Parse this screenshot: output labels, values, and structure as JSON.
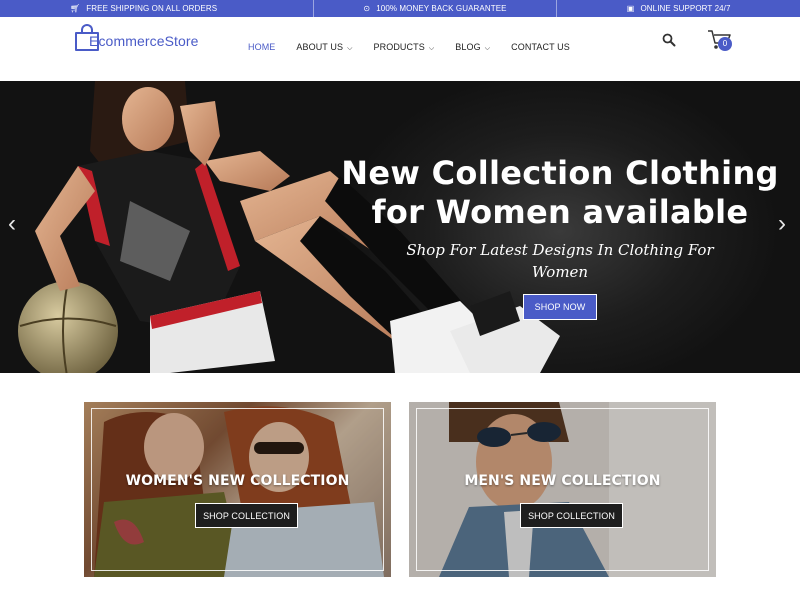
{
  "topbar": {
    "items": [
      {
        "icon": "cart-icon",
        "label": "FREE SHIPPING ON ALL ORDERS"
      },
      {
        "icon": "money-icon",
        "label": "100% MONEY BACK GUARANTEE"
      },
      {
        "icon": "support-icon",
        "label": "ONLINE SUPPORT 24/7"
      }
    ]
  },
  "brand": {
    "logo_text": "commerceStore",
    "logo_initial": "E",
    "accent_color": "#4a5bc7"
  },
  "nav": {
    "items": [
      {
        "label": "HOME",
        "active": true,
        "dropdown": false
      },
      {
        "label": "ABOUT US",
        "active": false,
        "dropdown": true
      },
      {
        "label": "PRODUCTS",
        "active": false,
        "dropdown": true
      },
      {
        "label": "BLOG",
        "active": false,
        "dropdown": true
      },
      {
        "label": "CONTACT US",
        "active": false,
        "dropdown": false
      }
    ]
  },
  "header": {
    "search_icon": "search-icon",
    "cart_icon": "cart-icon",
    "cart_count": "0"
  },
  "hero": {
    "title_line1": "New Collection Clothing",
    "title_line2": "for Women available",
    "subtitle": "Shop For Latest Designs In Clothing For Women",
    "button_label": "SHOP NOW",
    "prev_icon": "chevron-left-icon",
    "next_icon": "chevron-right-icon"
  },
  "collections": [
    {
      "title": "WOMEN'S NEW COLLECTION",
      "button_label": "SHOP COLLECTION"
    },
    {
      "title": "MEN'S NEW COLLECTION",
      "button_label": "SHOP COLLECTION"
    }
  ]
}
